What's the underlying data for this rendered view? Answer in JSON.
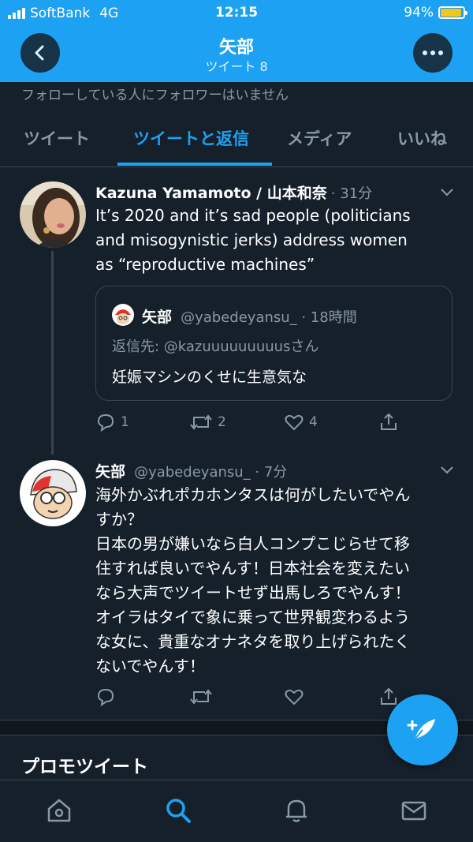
{
  "status": {
    "carrier": "SoftBank",
    "network": "4G",
    "time": "12:15",
    "battery": "94%",
    "battery_level": 0.94
  },
  "header": {
    "title": "矢部",
    "subtitle": "ツイート 8"
  },
  "follow_note": "フォローしている人にフォロワーはいません",
  "tabs": [
    {
      "label": "ツイート",
      "active": false
    },
    {
      "label": "ツイートと返信",
      "active": true
    },
    {
      "label": "メディア",
      "active": false
    },
    {
      "label": "いいね",
      "active": false
    }
  ],
  "tweet1": {
    "name": "Kazuna Yamamoto / 山本和奈",
    "time": "· 31分",
    "text_lines": [
      "It’s 2020 and it’s sad people (politicians",
      "and misogynistic jerks) address women",
      "as “reproductive machines”"
    ],
    "quote": {
      "name": "矢部",
      "handle_time": "@yabedeyansu_ · 18時間",
      "reply_to": "返信先: @kazuuuuuuuuusさん",
      "text": "妊娠マシンのくせに生意気な"
    },
    "actions": {
      "reply": "1",
      "retweet": "2",
      "like": "4"
    }
  },
  "tweet2": {
    "name": "矢部",
    "handle_time": "@yabedeyansu_ · 7分",
    "text_lines": [
      "海外かぶれポカホンタスは何がしたいでやん",
      "すか？",
      "日本の男が嫌いなら白人コンプこじらせて移",
      "住すれば良いでやんす！日本社会を変えたい",
      "なら大声でツイートせず出馬しろでやんす！",
      "オイラはタイで象に乗って世界観変わるよう",
      "な女に、貴重なオナネタを取り上げられたく",
      "ないでやんす！"
    ]
  },
  "promo_title": "プロモツイート",
  "colors": {
    "accent": "#1da1f2",
    "background": "#15202b",
    "muted": "#8899a6",
    "border": "#38444d"
  },
  "icons": [
    "back-arrow-icon",
    "more-dots-icon",
    "chevron-down-icon",
    "reply-icon",
    "retweet-icon",
    "like-icon",
    "share-icon",
    "compose-icon",
    "home-icon",
    "search-icon",
    "notifications-icon",
    "messages-icon"
  ]
}
